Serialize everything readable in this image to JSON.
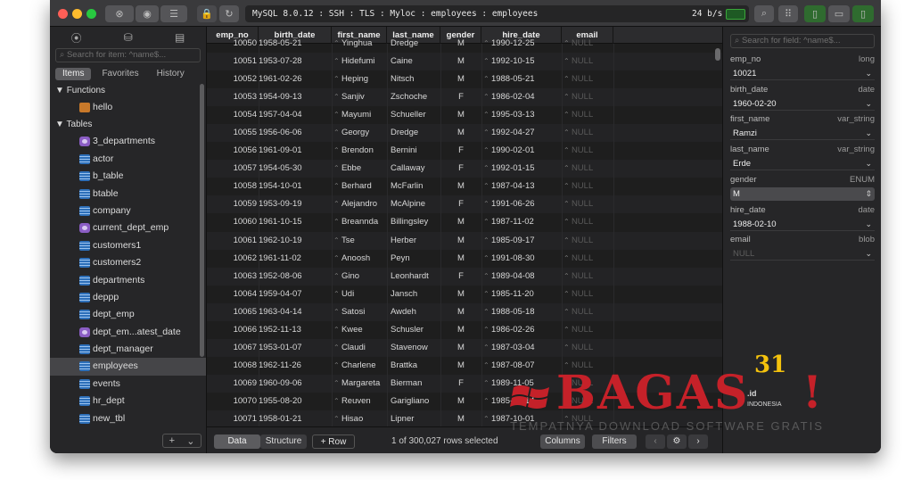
{
  "titlebar": {
    "connection": "MySQL 8.0.12 : SSH : TLS : Myloc : employees : employees",
    "speed": "24 b/s"
  },
  "sidebar": {
    "search_placeholder": "Search for item: ^name$...",
    "tabs": [
      "Items",
      "Favorites",
      "History"
    ],
    "functions_label": "Functions",
    "functions": [
      {
        "label": "hello",
        "icon": "function-icon"
      }
    ],
    "tables_label": "Tables",
    "tables": [
      {
        "label": "3_departments",
        "icon": "view-icon"
      },
      {
        "label": "actor",
        "icon": "table-icon"
      },
      {
        "label": "b_table",
        "icon": "table-icon"
      },
      {
        "label": "btable",
        "icon": "table-icon"
      },
      {
        "label": "company",
        "icon": "table-icon"
      },
      {
        "label": "current_dept_emp",
        "icon": "view-icon"
      },
      {
        "label": "customers1",
        "icon": "table-icon"
      },
      {
        "label": "customers2",
        "icon": "table-icon"
      },
      {
        "label": "departments",
        "icon": "table-icon"
      },
      {
        "label": "deppp",
        "icon": "table-icon"
      },
      {
        "label": "dept_emp",
        "icon": "table-icon"
      },
      {
        "label": "dept_em...atest_date",
        "icon": "view-icon"
      },
      {
        "label": "dept_manager",
        "icon": "table-icon"
      },
      {
        "label": "employees",
        "icon": "table-icon"
      },
      {
        "label": "events",
        "icon": "table-icon"
      },
      {
        "label": "hr_dept",
        "icon": "table-icon"
      },
      {
        "label": "new_tbl",
        "icon": "table-icon"
      }
    ]
  },
  "grid": {
    "columns": [
      "emp_no",
      "birth_date",
      "first_name",
      "last_name",
      "gender",
      "hire_date",
      "email"
    ],
    "partial_row": [
      "10050",
      "1958-05-21",
      "Yinghua",
      "Dredge",
      "M",
      "1990-12-25",
      "NULL"
    ],
    "rows": [
      [
        "10051",
        "1953-07-28",
        "Hidefumi",
        "Caine",
        "M",
        "1992-10-15",
        "NULL"
      ],
      [
        "10052",
        "1961-02-26",
        "Heping",
        "Nitsch",
        "M",
        "1988-05-21",
        "NULL"
      ],
      [
        "10053",
        "1954-09-13",
        "Sanjiv",
        "Zschoche",
        "F",
        "1986-02-04",
        "NULL"
      ],
      [
        "10054",
        "1957-04-04",
        "Mayumi",
        "Schueller",
        "M",
        "1995-03-13",
        "NULL"
      ],
      [
        "10055",
        "1956-06-06",
        "Georgy",
        "Dredge",
        "M",
        "1992-04-27",
        "NULL"
      ],
      [
        "10056",
        "1961-09-01",
        "Brendon",
        "Bernini",
        "F",
        "1990-02-01",
        "NULL"
      ],
      [
        "10057",
        "1954-05-30",
        "Ebbe",
        "Callaway",
        "F",
        "1992-01-15",
        "NULL"
      ],
      [
        "10058",
        "1954-10-01",
        "Berhard",
        "McFarlin",
        "M",
        "1987-04-13",
        "NULL"
      ],
      [
        "10059",
        "1953-09-19",
        "Alejandro",
        "McAlpine",
        "F",
        "1991-06-26",
        "NULL"
      ],
      [
        "10060",
        "1961-10-15",
        "Breannda",
        "Billingsley",
        "M",
        "1987-11-02",
        "NULL"
      ],
      [
        "10061",
        "1962-10-19",
        "Tse",
        "Herber",
        "M",
        "1985-09-17",
        "NULL"
      ],
      [
        "10062",
        "1961-11-02",
        "Anoosh",
        "Peyn",
        "M",
        "1991-08-30",
        "NULL"
      ],
      [
        "10063",
        "1952-08-06",
        "Gino",
        "Leonhardt",
        "F",
        "1989-04-08",
        "NULL"
      ],
      [
        "10064",
        "1959-04-07",
        "Udi",
        "Jansch",
        "M",
        "1985-11-20",
        "NULL"
      ],
      [
        "10065",
        "1963-04-14",
        "Satosi",
        "Awdeh",
        "M",
        "1988-05-18",
        "NULL"
      ],
      [
        "10066",
        "1952-11-13",
        "Kwee",
        "Schusler",
        "M",
        "1986-02-26",
        "NULL"
      ],
      [
        "10067",
        "1953-01-07",
        "Claudi",
        "Stavenow",
        "M",
        "1987-03-04",
        "NULL"
      ],
      [
        "10068",
        "1962-11-26",
        "Charlene",
        "Brattka",
        "M",
        "1987-08-07",
        "NULL"
      ],
      [
        "10069",
        "1960-09-06",
        "Margareta",
        "Bierman",
        "F",
        "1989-11-05",
        "NULL"
      ],
      [
        "10070",
        "1955-08-20",
        "Reuven",
        "Garigliano",
        "M",
        "1985-10-14",
        "NULL"
      ],
      [
        "10071",
        "1958-01-21",
        "Hisao",
        "Lipner",
        "M",
        "1987-10-01",
        "NULL"
      ]
    ]
  },
  "bottombar": {
    "data_tab": "Data",
    "structure_tab": "Structure",
    "add_row": "+ Row",
    "row_count": "1 of 300,027 rows selected",
    "columns_btn": "Columns",
    "filters_btn": "Filters"
  },
  "panel": {
    "search_placeholder": "Search for field: ^name$...",
    "fields": [
      {
        "name": "emp_no",
        "type": "long",
        "value": "10021",
        "style": "dropdown"
      },
      {
        "name": "birth_date",
        "type": "date",
        "value": "1960-02-20",
        "style": "dropdown"
      },
      {
        "name": "first_name",
        "type": "var_string",
        "value": "Ramzi",
        "style": "dropdown"
      },
      {
        "name": "last_name",
        "type": "var_string",
        "value": "Erde",
        "style": "dropdown"
      },
      {
        "name": "gender",
        "type": "ENUM",
        "value": "M",
        "style": "enum"
      },
      {
        "name": "hire_date",
        "type": "date",
        "value": "1988-02-10",
        "style": "dropdown"
      },
      {
        "name": "email",
        "type": "blob",
        "value": "NULL",
        "style": "null"
      }
    ]
  },
  "watermark": {
    "brand": "BAGAS",
    "number": "31",
    "suffix": ".id",
    "country": "INDONESIA",
    "tagline": "TEMPATNYA DOWNLOAD SOFTWARE GRATIS"
  },
  "colors": {
    "window_bg": "#1e1e1e",
    "sidebar_bg": "#262628",
    "selected_row": "#454548",
    "table_icon": "#2d6fb9",
    "view_icon": "#8b5dc4",
    "function_icon": "#c8792a",
    "traffic_close": "#ff5f57",
    "traffic_min": "#febc2e",
    "traffic_max": "#28c840",
    "watermark_red": "#c52129",
    "watermark_gold": "#f4c20d"
  }
}
